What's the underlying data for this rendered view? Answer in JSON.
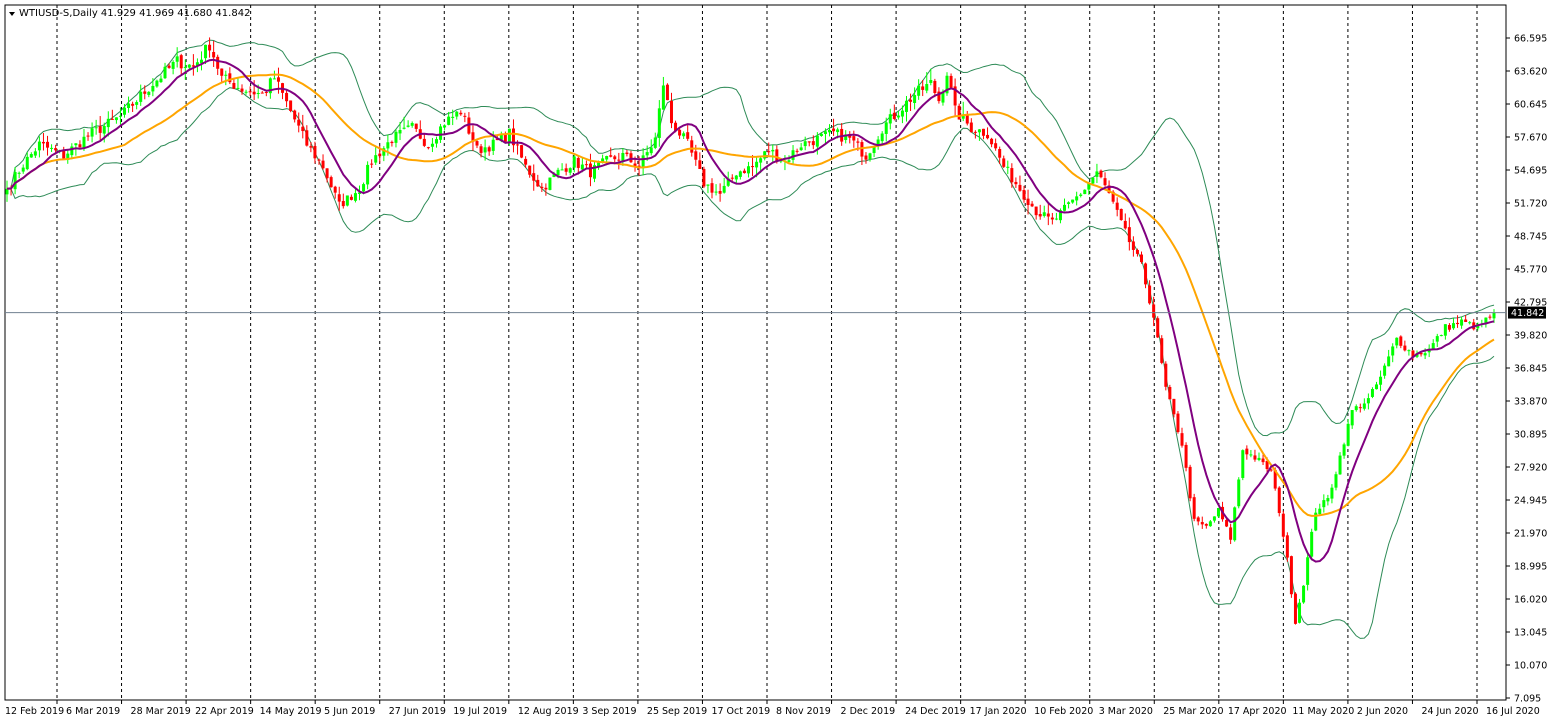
{
  "chart_data": {
    "type": "candlestick",
    "symbol": "WTIUSD-S",
    "timeframe": "Daily",
    "ohlc_header": {
      "open": "41.929",
      "high": "41.969",
      "low": "41.680",
      "close": "41.842"
    },
    "current_price": "41.842",
    "ylim": [
      7.095,
      68.5
    ],
    "y_ticks": [
      "66.595",
      "63.620",
      "60.645",
      "57.670",
      "54.695",
      "51.720",
      "48.745",
      "45.770",
      "42.795",
      "39.820",
      "36.845",
      "33.870",
      "30.895",
      "27.920",
      "24.945",
      "21.970",
      "18.995",
      "16.020",
      "13.045",
      "10.070",
      "7.095"
    ],
    "x_labels": [
      "12 Feb 2019",
      "6 Mar 2019",
      "28 Mar 2019",
      "22 Apr 2019",
      "14 May 2019",
      "5 Jun 2019",
      "27 Jun 2019",
      "19 Jul 2019",
      "12 Aug 2019",
      "3 Sep 2019",
      "25 Sep 2019",
      "17 Oct 2019",
      "8 Nov 2019",
      "2 Dec 2019",
      "24 Dec 2019",
      "17 Jan 2020",
      "10 Feb 2020",
      "3 Mar 2020",
      "25 Mar 2020",
      "17 Apr 2020",
      "11 May 2020",
      "2 Jun 2020",
      "24 Jun 2020",
      "16 Jul 2020"
    ],
    "close_anchors": [
      [
        0,
        53.0
      ],
      [
        4,
        55.2
      ],
      [
        8,
        57.0
      ],
      [
        14,
        56.0
      ],
      [
        20,
        57.8
      ],
      [
        28,
        59.5
      ],
      [
        36,
        62.5
      ],
      [
        42,
        64.5
      ],
      [
        46,
        64.0
      ],
      [
        50,
        66.0
      ],
      [
        53,
        63.0
      ],
      [
        58,
        62.0
      ],
      [
        63,
        61.5
      ],
      [
        66,
        63.0
      ],
      [
        70,
        60.0
      ],
      [
        74,
        57.0
      ],
      [
        78,
        55.0
      ],
      [
        82,
        51.5
      ],
      [
        87,
        53.0
      ],
      [
        90,
        55.5
      ],
      [
        95,
        57.5
      ],
      [
        100,
        58.5
      ],
      [
        104,
        57.0
      ],
      [
        108,
        59.0
      ],
      [
        112,
        60.0
      ],
      [
        116,
        56.5
      ],
      [
        120,
        57.0
      ],
      [
        124,
        58.0
      ],
      [
        128,
        55.0
      ],
      [
        132,
        53.0
      ],
      [
        136,
        54.5
      ],
      [
        140,
        55.5
      ],
      [
        144,
        54.5
      ],
      [
        148,
        55.5
      ],
      [
        152,
        56.0
      ],
      [
        156,
        55.0
      ],
      [
        160,
        57.5
      ],
      [
        162,
        62.5
      ],
      [
        164,
        59.0
      ],
      [
        168,
        57.0
      ],
      [
        172,
        53.5
      ],
      [
        176,
        52.5
      ],
      [
        180,
        54.5
      ],
      [
        184,
        55.0
      ],
      [
        188,
        56.5
      ],
      [
        192,
        55.5
      ],
      [
        196,
        57.0
      ],
      [
        200,
        57.5
      ],
      [
        204,
        58.0
      ],
      [
        208,
        57.5
      ],
      [
        212,
        56.0
      ],
      [
        216,
        58.5
      ],
      [
        220,
        60.0
      ],
      [
        224,
        61.5
      ],
      [
        228,
        62.5
      ],
      [
        230,
        61.0
      ],
      [
        232,
        63.5
      ],
      [
        234,
        60.0
      ],
      [
        238,
        58.5
      ],
      [
        242,
        58.0
      ],
      [
        246,
        55.0
      ],
      [
        250,
        53.0
      ],
      [
        254,
        51.0
      ],
      [
        258,
        50.0
      ],
      [
        262,
        51.5
      ],
      [
        266,
        53.0
      ],
      [
        269,
        54.5
      ],
      [
        272,
        52.5
      ],
      [
        276,
        49.0
      ],
      [
        280,
        46.0
      ],
      [
        283,
        41.5
      ],
      [
        286,
        35.0
      ],
      [
        290,
        30.0
      ],
      [
        293,
        23.0
      ],
      [
        296,
        22.5
      ],
      [
        299,
        24.0
      ],
      [
        302,
        21.5
      ],
      [
        305,
        29.5
      ],
      [
        309,
        28.5
      ],
      [
        312,
        27.5
      ],
      [
        314,
        24.0
      ],
      [
        316,
        19.5
      ],
      [
        318,
        14.0
      ],
      [
        320,
        17.5
      ],
      [
        323,
        24.0
      ],
      [
        326,
        25.0
      ],
      [
        328,
        27.5
      ],
      [
        332,
        33.0
      ],
      [
        336,
        34.0
      ],
      [
        339,
        36.0
      ],
      [
        343,
        39.5
      ],
      [
        347,
        38.0
      ],
      [
        351,
        38.5
      ],
      [
        355,
        40.5
      ],
      [
        359,
        41.0
      ],
      [
        363,
        40.5
      ],
      [
        367,
        41.8
      ]
    ],
    "indicators": {
      "bollinger_bands": true,
      "moving_averages": [
        {
          "color": "#800080"
        },
        {
          "color": "#ffa500"
        }
      ]
    },
    "colors": {
      "bull": "#00ff00",
      "bear": "#ff0000",
      "ma_fast": "#800080",
      "ma_slow": "#ffa500",
      "bands": "#2e8b57",
      "price_line": "#708090",
      "price_tag": "#000000"
    },
    "grid": "vertical-dashed"
  }
}
